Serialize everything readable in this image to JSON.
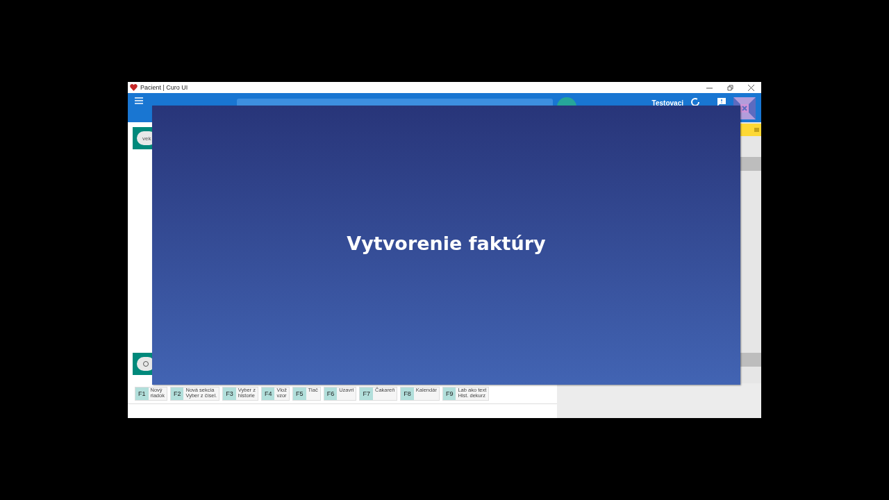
{
  "window": {
    "title": "Pacient | Curo UI"
  },
  "app_bar": {
    "user": "Testovaci"
  },
  "patient_chips": [
    {
      "label": "vek"
    }
  ],
  "function_keys": [
    {
      "key": "F1",
      "label": "Nový\nriadok"
    },
    {
      "key": "F2",
      "label": "Nová sekcia\nVyber z čísel."
    },
    {
      "key": "F3",
      "label": "Vyber z\nhistorie"
    },
    {
      "key": "F4",
      "label": "Vlož\nvzor"
    },
    {
      "key": "F5",
      "label": "Tlač"
    },
    {
      "key": "F6",
      "label": "Uzavri"
    },
    {
      "key": "F7",
      "label": "Čakareň"
    },
    {
      "key": "F8",
      "label": "Kalendár"
    },
    {
      "key": "F9",
      "label": "Lab ako text\nHist. dekurz"
    }
  ],
  "slide": {
    "title": "Vytvorenie faktúry"
  }
}
